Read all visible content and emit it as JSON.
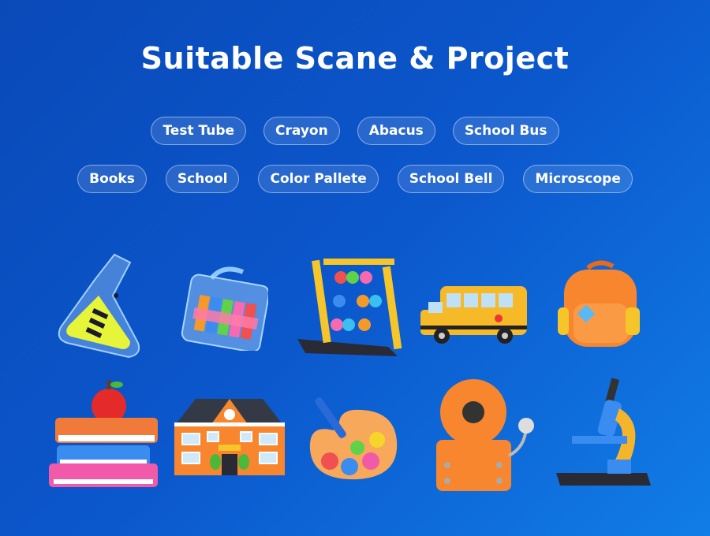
{
  "title": "Suitable Scane & Project",
  "tags_row1": [
    "Test Tube",
    "Crayon",
    "Abacus",
    "School Bus"
  ],
  "tags_row2": [
    "Books",
    "School",
    "Color Pallete",
    "School Bell",
    "Microscope"
  ],
  "illustrations": [
    "test-tube",
    "crayon",
    "abacus",
    "school-bus",
    "backpack",
    "books",
    "school",
    "color-pallete",
    "school-bell",
    "microscope"
  ],
  "colors": {
    "background": "#0b57cc",
    "accent": "#f47c2a"
  }
}
